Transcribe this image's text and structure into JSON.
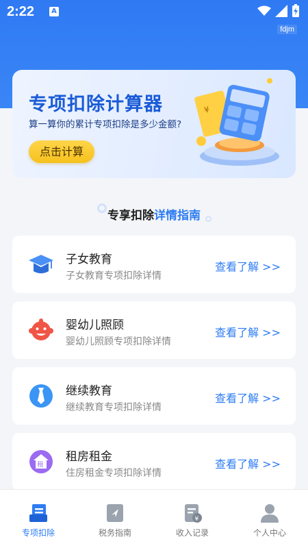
{
  "status_bar": {
    "time": "2:22",
    "notice_letter": "A"
  },
  "tag": "fdjm",
  "banner": {
    "title": "专项扣除计算器",
    "subtitle": "算一算你的累计专项扣除是多少金额?",
    "button": "点击计算",
    "art_icon": "calculator-coins-illustration"
  },
  "section": {
    "title_plain": "专享扣除",
    "title_highlight": "详情指南"
  },
  "cards": [
    {
      "title": "子女教育",
      "desc": "子女教育专项扣除详情",
      "link": "查看了解 >>",
      "icon": "graduation-cap-icon"
    },
    {
      "title": "婴幼儿照顾",
      "desc": "婴幼儿照顾专项扣除详情",
      "link": "查看了解 >>",
      "icon": "baby-face-icon"
    },
    {
      "title": "继续教育",
      "desc": "继续教育专项扣除详情",
      "link": "查看了解 >>",
      "icon": "tie-icon"
    },
    {
      "title": "租房租金",
      "desc": "住房租金专项扣除详情",
      "link": "查看了解 >>",
      "icon": "house-rent-icon"
    }
  ],
  "tabs": [
    {
      "label": "专项扣除",
      "icon": "document-list-icon",
      "active": true
    },
    {
      "label": "税务指南",
      "icon": "guide-book-icon",
      "active": false
    },
    {
      "label": "收入记录",
      "icon": "income-record-icon",
      "active": false
    },
    {
      "label": "个人中心",
      "icon": "person-icon",
      "active": false
    }
  ],
  "colors": {
    "primary": "#2d7cf3",
    "banner_title": "#1a5bd6",
    "button": "#f6c11e",
    "bg": "#f3f5f9"
  }
}
